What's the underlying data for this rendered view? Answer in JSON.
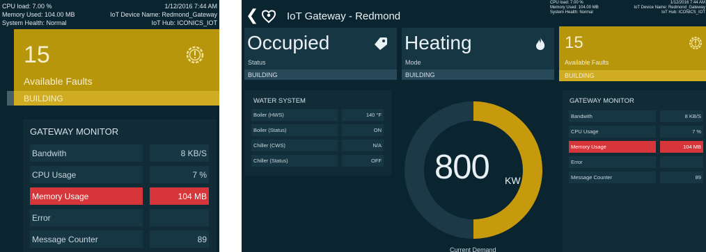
{
  "status": {
    "cpu_load": "CPU load: 7.00 %",
    "memory_used": "Memory Used: 104.00 MB",
    "system_health": "System Health: Normal",
    "datetime": "1/12/2016 7:44 AM",
    "device_name": "IoT Device Name: Redmond_Gateway",
    "iot_hub": "IoT Hub: ICONICS_IOT"
  },
  "left_panel": {
    "faults_count": "15",
    "faults_label": "Available Faults",
    "faults_category": "BUILDING",
    "monitor_title": "GATEWAY MONITOR",
    "monitor_rows": [
      {
        "label": "Bandwith",
        "value": "8 KB/S",
        "alert": false
      },
      {
        "label": "CPU Usage",
        "value": "7 %",
        "alert": false
      },
      {
        "label": "Memory Usage",
        "value": "104 MB",
        "alert": true
      },
      {
        "label": "Error",
        "value": "",
        "alert": false
      },
      {
        "label": "Message Counter",
        "value": "89",
        "alert": false
      }
    ]
  },
  "header": {
    "back_glyph": "❮",
    "title": "IoT Gateway - Redmond"
  },
  "tiles": {
    "occupancy": {
      "value": "Occupied",
      "label": "Status",
      "category": "BUILDING"
    },
    "mode": {
      "value": "Heating",
      "label": "Mode",
      "category": "BUILDING"
    }
  },
  "water_system": {
    "title": "WATER SYSTEM",
    "rows": [
      {
        "label": "Boiler (HWS)",
        "value": "140 °F"
      },
      {
        "label": "Boiler (Status)",
        "value": "ON"
      },
      {
        "label": "Chiller (CWS)",
        "value": "N/A"
      },
      {
        "label": "Chiller (Status)",
        "value": "OFF"
      }
    ]
  },
  "demand": {
    "value": "800",
    "unit": "KW",
    "label": "Current Demand",
    "fill_fraction": 0.5
  },
  "right_panel": {
    "faults_count": "15",
    "faults_label": "Available Faults",
    "faults_category": "BUILDING",
    "monitor_title": "GATEWAY MONITOR",
    "monitor_rows": [
      {
        "label": "Bandwith",
        "value": "8 KB/S",
        "alert": false
      },
      {
        "label": "CPU Usage",
        "value": "7 %",
        "alert": false
      },
      {
        "label": "Memory Usage",
        "value": "104 MB",
        "alert": true
      },
      {
        "label": "Error",
        "value": "",
        "alert": false
      },
      {
        "label": "Message Counter",
        "value": "89",
        "alert": false
      }
    ]
  },
  "colors": {
    "background": "#0a2430",
    "tile": "#173644",
    "fault_gold": "#b8960c",
    "building_gold": "#cfac22",
    "alert_red": "#d6363a",
    "gauge_fill": "#c79a0e",
    "gauge_track": "#1c3947"
  },
  "icons": {
    "back": "chevron-left-icon",
    "logo": "puzzle-logo-icon",
    "occupied": "tag-icon",
    "heating": "flame-icon",
    "faults": "gear-warning-icon"
  }
}
